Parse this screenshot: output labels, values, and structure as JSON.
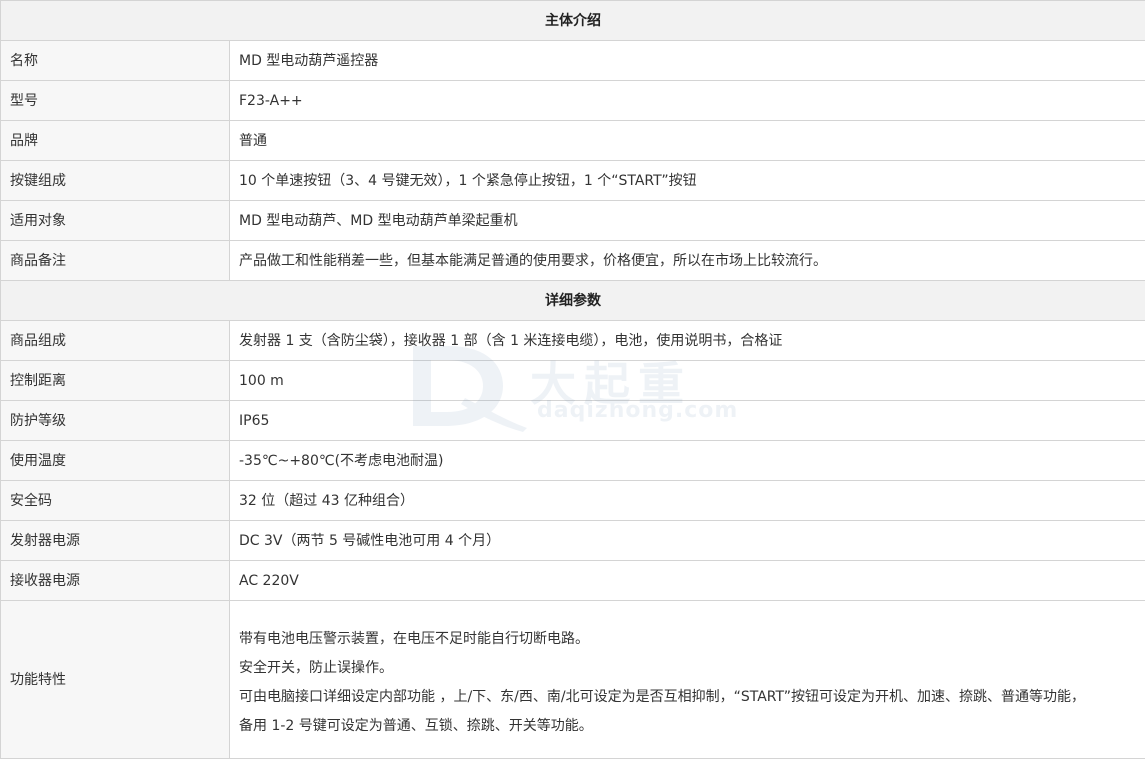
{
  "sections": {
    "intro_title": "主体介绍",
    "detail_title": "详细参数"
  },
  "intro_rows": [
    {
      "label": "名称",
      "value": "MD 型电动葫芦遥控器"
    },
    {
      "label": "型号",
      "value": "F23-A++"
    },
    {
      "label": "品牌",
      "value": "普通"
    },
    {
      "label": "按键组成",
      "value": "10 个单速按钮（3、4 号键无效），1 个紧急停止按钮，1 个“START”按钮"
    },
    {
      "label": "适用对象",
      "value": "MD 型电动葫芦、MD 型电动葫芦单梁起重机"
    },
    {
      "label": "商品备注",
      "value": "产品做工和性能稍差一些，但基本能满足普通的使用要求，价格便宜，所以在市场上比较流行。"
    }
  ],
  "detail_rows": [
    {
      "label": "商品组成",
      "value": "发射器 1 支（含防尘袋），接收器 1 部（含 1 米连接电缆），电池，使用说明书，合格证"
    },
    {
      "label": "控制距离",
      "value": "100 m"
    },
    {
      "label": "防护等级",
      "value": "IP65"
    },
    {
      "label": "使用温度",
      "value": "-35℃~+80℃(不考虑电池耐温)"
    },
    {
      "label": "安全码",
      "value": "32 位（超过 43 亿种组合）"
    },
    {
      "label": "发射器电源",
      "value": "DC 3V（两节 5 号碱性电池可用 4 个月）"
    },
    {
      "label": "接收器电源",
      "value": "AC 220V"
    }
  ],
  "features": {
    "label": "功能特性",
    "lines": [
      "带有电池电压警示装置，在电压不足时能自行切断电路。",
      "安全开关，防止误操作。",
      "可由电脑接口详细设定内部功能 ，上/下、东/西、南/北可设定为是否互相抑制，“START”按钮可设定为开机、加速、捺跳、普通等功能，",
      "备用 1-2 号键可设定为普通、互锁、捺跳、开关等功能。"
    ]
  },
  "watermark": {
    "brand_text": "大起重",
    "domain_text": "daqizhong.com"
  }
}
